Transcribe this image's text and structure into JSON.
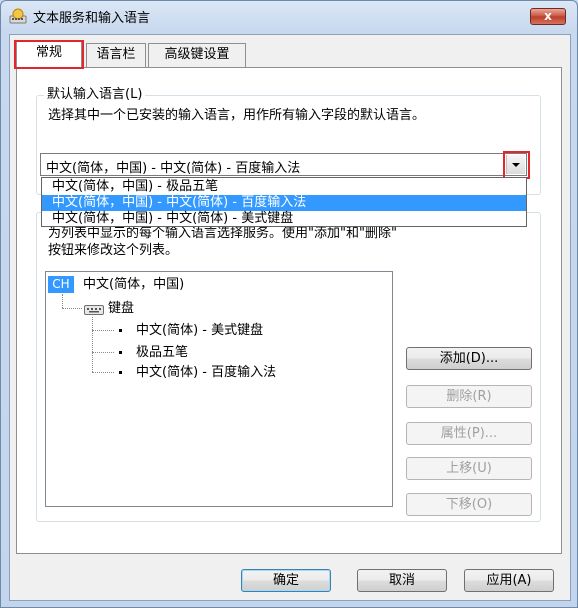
{
  "window": {
    "title": "文本服务和输入语言",
    "close_label": "x"
  },
  "tabs": [
    {
      "label": "常规",
      "active": true
    },
    {
      "label": "语言栏",
      "active": false
    },
    {
      "label": "高级键设置",
      "active": false
    }
  ],
  "default_language": {
    "legend": "默认输入语言(L)",
    "description": "选择其中一个已安装的输入语言，用作所有输入字段的默认语言。",
    "selected_value": "中文(简体，中国) - 中文(简体) - 百度输入法",
    "options": [
      "中文(简体，中国) - 极品五笔",
      "中文(简体，中国) - 中文(简体) - 百度输入法",
      "中文(简体，中国) - 中文(简体) - 美式键盘"
    ],
    "highlighted_index": 1
  },
  "installed_services": {
    "description_line1": "为列表中显示的每个输入语言选择服务。使用\"添加\"和\"删除\"",
    "description_line2": "按钮来修改这个列表。",
    "tree": {
      "language_code": "CH",
      "language": "中文(简体，中国)",
      "category": "键盘",
      "items": [
        "中文(简体) - 美式键盘",
        "极品五笔",
        "中文(简体) - 百度输入法"
      ]
    },
    "buttons": {
      "add": "添加(D)...",
      "remove": "删除(R)",
      "properties": "属性(P)...",
      "move_up": "上移(U)",
      "move_down": "下移(O)"
    }
  },
  "footer": {
    "ok": "确定",
    "cancel": "取消",
    "apply": "应用(A)"
  },
  "colors": {
    "accent": "#3399ff",
    "highlight_box": "#e4262c"
  }
}
